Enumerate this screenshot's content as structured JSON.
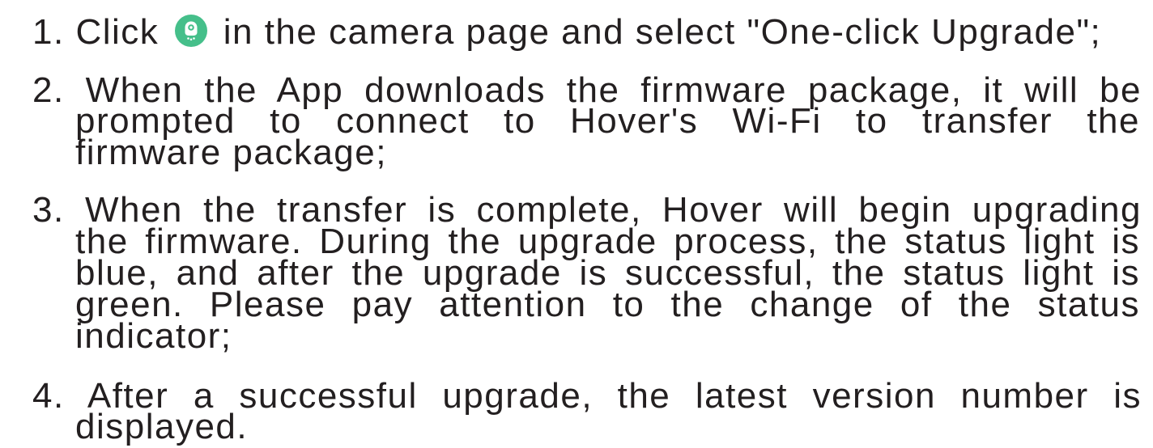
{
  "colors": {
    "text": "#231f20",
    "icon_green": "#45bf8a",
    "icon_fg": "#ffffff",
    "background": "#ffffff"
  },
  "steps": [
    {
      "number": "1.",
      "text_before_icon": "Click",
      "icon": "rocket-icon",
      "text_after_icon": "in the camera page and select \"One-click Upgrade\";"
    },
    {
      "number": "2.",
      "lines": [
        "When the App downloads the firmware package, it will be",
        "prompted to connect to Hover's Wi-Fi to transfer the",
        "firmware package;"
      ]
    },
    {
      "number": "3.",
      "lines": [
        "When the transfer is complete, Hover will begin upgrading",
        "the firmware. During the upgrade process, the status light is",
        "blue, and after the upgrade is successful, the status light is",
        "green. Please pay attention to the change of the status",
        "indicator;"
      ]
    },
    {
      "number": "4.",
      "lines": [
        "After a successful upgrade, the latest version number is",
        "displayed."
      ]
    }
  ]
}
